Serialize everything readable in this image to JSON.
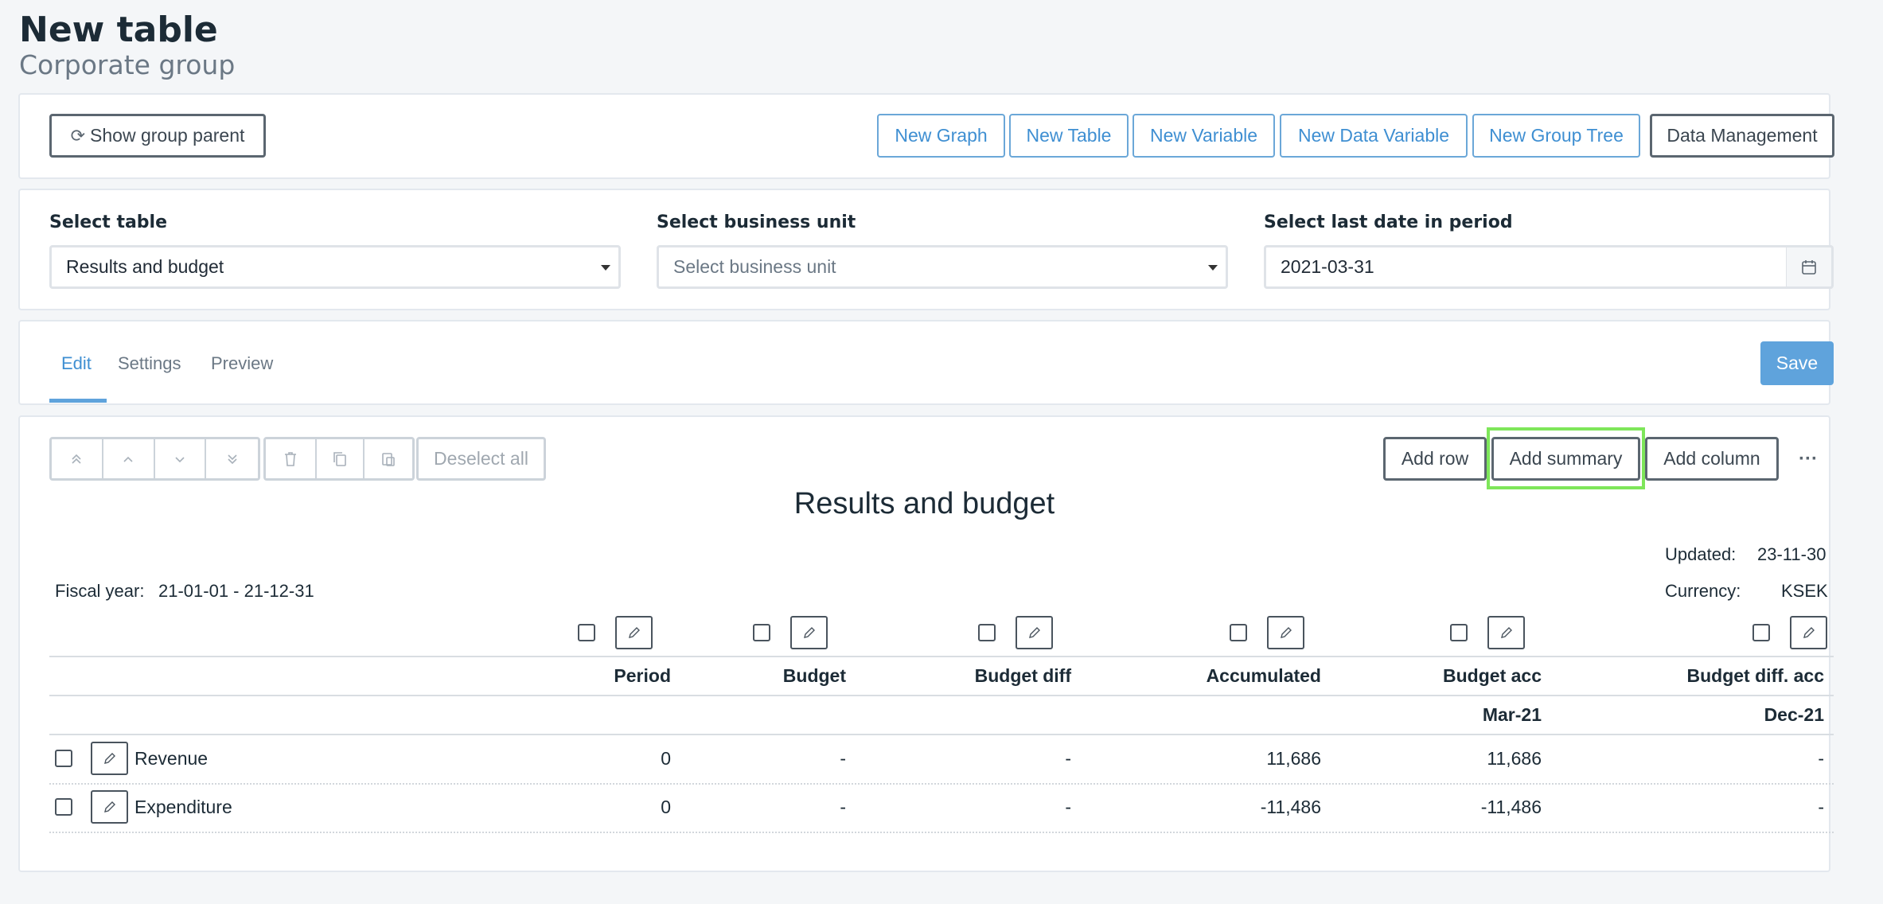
{
  "page": {
    "title": "New table",
    "subtitle": "Corporate group"
  },
  "actions": {
    "show_group_parent": "Show group parent",
    "new_graph": "New Graph",
    "new_table": "New Table",
    "new_variable": "New Variable",
    "new_data_variable": "New Data Variable",
    "new_group_tree": "New Group Tree",
    "data_management": "Data Management"
  },
  "selects": {
    "table": {
      "label": "Select table",
      "value": "Results and budget"
    },
    "business_unit": {
      "label": "Select business unit",
      "placeholder": "Select business unit"
    },
    "last_date": {
      "label": "Select last date in period",
      "value": "2021-03-31"
    }
  },
  "tabs": {
    "edit": "Edit",
    "settings": "Settings",
    "preview": "Preview",
    "active": "Edit"
  },
  "save_label": "Save",
  "toolbar": {
    "deselect_all": "Deselect all",
    "add_row": "Add row",
    "add_summary": "Add summary",
    "add_column": "Add column",
    "more": "···"
  },
  "table": {
    "title": "Results and budget",
    "fiscal_label": "Fiscal year:",
    "fiscal_value": "21-01-01 - 21-12-31",
    "updated_label": "Updated:",
    "updated_value": "23-11-30",
    "currency_label": "Currency:",
    "currency_value": "KSEK",
    "columns": [
      {
        "header": "Period",
        "sub": ""
      },
      {
        "header": "Budget",
        "sub": ""
      },
      {
        "header": "Budget diff",
        "sub": ""
      },
      {
        "header": "Accumulated",
        "sub": ""
      },
      {
        "header": "Budget acc",
        "sub": "Mar-21"
      },
      {
        "header": "Budget diff. acc",
        "sub": "Dec-21"
      }
    ],
    "rows": [
      {
        "label": "Revenue",
        "cells": [
          "0",
          "-",
          "-",
          "11,686",
          "11,686",
          "-"
        ]
      },
      {
        "label": "Expenditure",
        "cells": [
          "0",
          "-",
          "-",
          "-11,486",
          "-11,486",
          "-"
        ]
      }
    ]
  },
  "highlight_color": "#7ee65a"
}
